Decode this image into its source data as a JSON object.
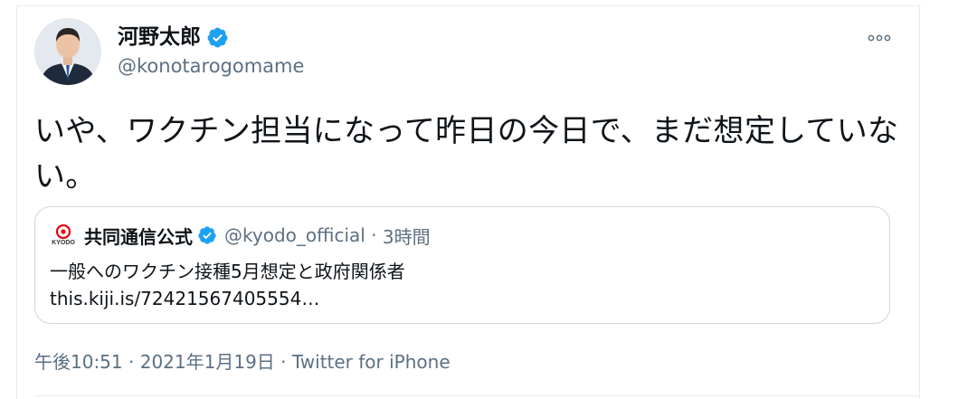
{
  "tweet": {
    "author": {
      "display_name": "河野太郎",
      "handle": "@konotarogomame",
      "verified": true
    },
    "text": "いや、ワクチン担当になって昨日の今日で、まだ想定していない。",
    "more_icon": "more-horizontal-icon",
    "quoted": {
      "logo_text": "KYODO",
      "display_name": "共同通信公式",
      "verified": true,
      "handle": "@kyodo_official",
      "separator": " · ",
      "time": "3時間",
      "text": "一般へのワクチン接種5月想定と政府関係者",
      "link": "this.kiji.is/72421567405554…"
    },
    "meta": {
      "time": "午後10:51",
      "separator1": " · ",
      "date": "2021年1月19日",
      "separator2": " · ",
      "source": "Twitter for iPhone"
    }
  },
  "colors": {
    "verified_blue": "#1da1f2",
    "secondary_text": "#5b7083",
    "border": "#ccd6dd",
    "kyodo_red": "#e60012"
  }
}
